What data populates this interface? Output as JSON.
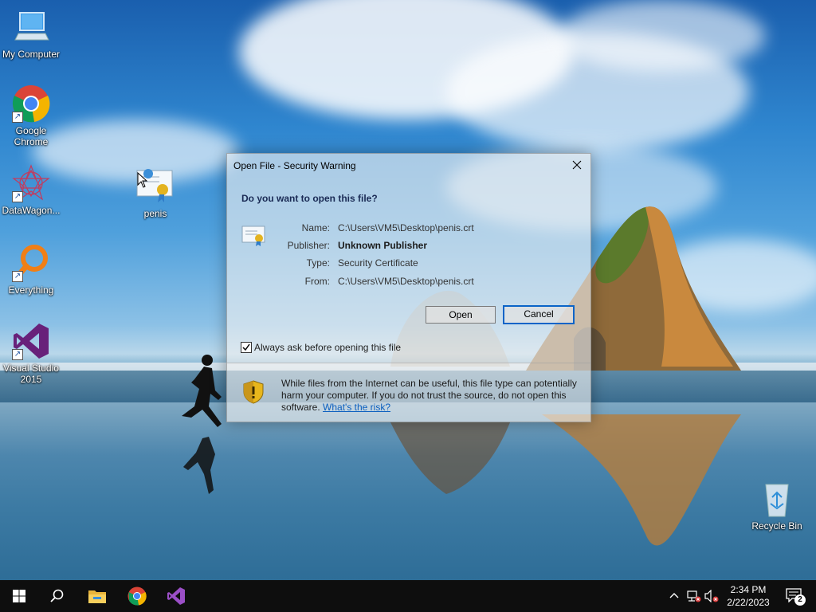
{
  "desktop": {
    "icons": [
      {
        "label": "My Computer"
      },
      {
        "label": "Google Chrome"
      },
      {
        "label": "DataWagon..."
      },
      {
        "label": "penis"
      },
      {
        "label": "Everything"
      },
      {
        "label": "Visual Studio 2015"
      },
      {
        "label": "Recycle Bin"
      }
    ]
  },
  "dialog": {
    "title": "Open File - Security Warning",
    "question": "Do you want to open this file?",
    "fields": [
      {
        "label": "Name:",
        "value": "C:\\Users\\VM5\\Desktop\\penis.crt"
      },
      {
        "label": "Publisher:",
        "value": "Unknown Publisher"
      },
      {
        "label": "Type:",
        "value": "Security Certificate"
      },
      {
        "label": "From:",
        "value": "C:\\Users\\VM5\\Desktop\\penis.crt"
      }
    ],
    "open_label": "Open",
    "cancel_label": "Cancel",
    "checkbox_label": "Always ask before opening this file",
    "checkbox_checked": true,
    "warning_text": "While files from the Internet can be useful, this file type can potentially harm your computer. If you do not trust the source, do not open this software.",
    "warning_link": "What's the risk?"
  },
  "taskbar": {
    "time": "2:34 PM",
    "date": "2/22/2023",
    "notification_count": "2",
    "pinned": [
      "start-icon",
      "search-icon",
      "file-explorer-icon",
      "chrome-icon",
      "visual-studio-icon"
    ]
  },
  "colors": {
    "accent": "#0a64c8",
    "taskbar": "#0e0e0e",
    "link": "#0b5fbf"
  }
}
